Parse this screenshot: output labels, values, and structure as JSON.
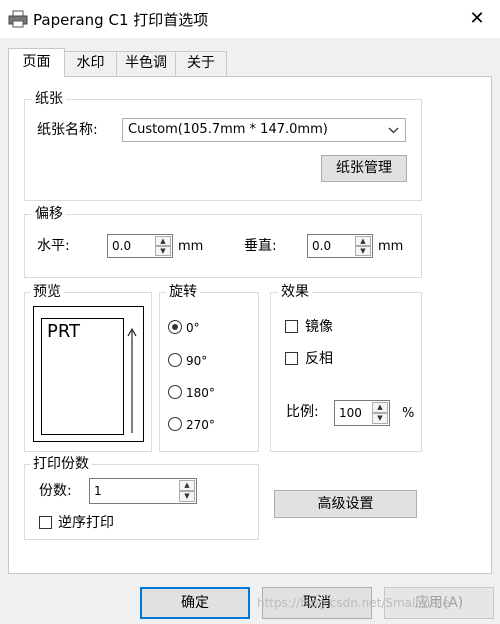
{
  "window": {
    "title": "Paperang C1 打印首选项",
    "close_glyph": "✕"
  },
  "tabs": [
    {
      "label": "页面",
      "active": true
    },
    {
      "label": "水印",
      "active": false
    },
    {
      "label": "半色调",
      "active": false
    },
    {
      "label": "关于",
      "active": false
    }
  ],
  "paper": {
    "group_label": "纸张",
    "name_label": "纸张名称:",
    "selected": "Custom(105.7mm * 147.0mm)",
    "manage_button": "纸张管理"
  },
  "offset": {
    "group_label": "偏移",
    "horizontal_label": "水平:",
    "horizontal_value": "0.0",
    "vertical_label": "垂直:",
    "vertical_value": "0.0",
    "unit": "mm"
  },
  "preview": {
    "group_label": "预览",
    "sample_text": "PRT"
  },
  "rotation": {
    "group_label": "旋转",
    "options": [
      "0°",
      "90°",
      "180°",
      "270°"
    ],
    "selected_index": 0
  },
  "effects": {
    "group_label": "效果",
    "mirror_label": "镜像",
    "mirror_checked": false,
    "invert_label": "反相",
    "invert_checked": false,
    "scale_label": "比例:",
    "scale_value": "100",
    "scale_unit": "%"
  },
  "copies": {
    "group_label": "打印份数",
    "count_label": "份数:",
    "count_value": "1",
    "reverse_label": "逆序打印",
    "reverse_checked": false
  },
  "advanced_button": "高级设置",
  "footer": {
    "ok": "确定",
    "cancel": "取消",
    "apply": "应用(A)",
    "watermark": "https://blog.csdn.net/SmallAitee"
  }
}
